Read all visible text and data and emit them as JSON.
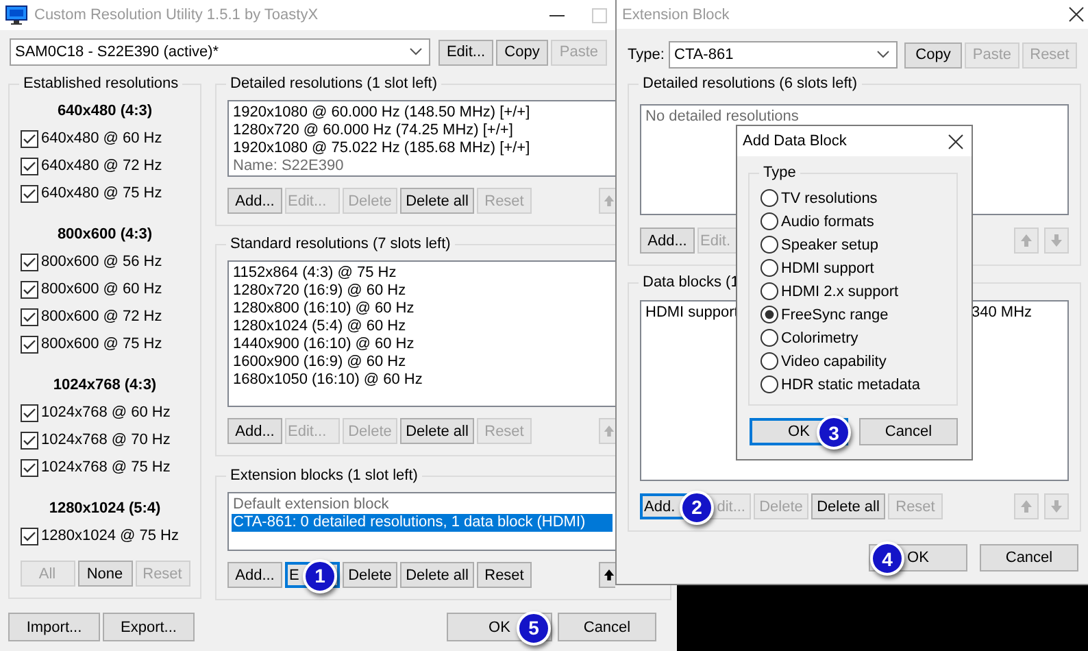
{
  "main_window": {
    "title": "Custom Resolution Utility 1.5.1 by ToastyX",
    "active": false,
    "monitor": "SAM0C18 - S22E390 (active)*",
    "top_buttons": [
      {
        "label": "Edit...",
        "disabled": false
      },
      {
        "label": "Copy",
        "disabled": false
      },
      {
        "label": "Paste",
        "disabled": true
      }
    ],
    "established": {
      "title": "Established resolutions",
      "groups": [
        {
          "heading": "640x480 (4:3)",
          "items": [
            {
              "label": "640x480 @ 60 Hz",
              "checked": true
            },
            {
              "label": "640x480 @ 72 Hz",
              "checked": true
            },
            {
              "label": "640x480 @ 75 Hz",
              "checked": true
            }
          ]
        },
        {
          "heading": "800x600 (4:3)",
          "items": [
            {
              "label": "800x600 @ 56 Hz",
              "checked": true
            },
            {
              "label": "800x600 @ 60 Hz",
              "checked": true
            },
            {
              "label": "800x600 @ 72 Hz",
              "checked": true
            },
            {
              "label": "800x600 @ 75 Hz",
              "checked": true
            }
          ]
        },
        {
          "heading": "1024x768 (4:3)",
          "items": [
            {
              "label": "1024x768 @ 60 Hz",
              "checked": true
            },
            {
              "label": "1024x768 @ 70 Hz",
              "checked": true
            },
            {
              "label": "1024x768 @ 75 Hz",
              "checked": true
            }
          ]
        },
        {
          "heading": "1280x1024 (5:4)",
          "items": [
            {
              "label": "1280x1024 @ 75 Hz",
              "checked": true
            }
          ]
        }
      ],
      "buttons": [
        {
          "label": "All",
          "disabled": true
        },
        {
          "label": "None",
          "disabled": false
        },
        {
          "label": "Reset",
          "disabled": true
        }
      ]
    },
    "detailed": {
      "title": "Detailed resolutions (1 slot left)",
      "items": [
        {
          "text": "1920x1080 @ 60.000 Hz (148.50 MHz) [+/+]",
          "kind": "entry"
        },
        {
          "text": "1280x720 @ 60.000 Hz (74.25 MHz) [+/+]",
          "kind": "entry"
        },
        {
          "text": "1920x1080 @ 75.022 Hz (185.68 MHz) [+/+]",
          "kind": "entry"
        },
        {
          "text": "Name: S22E390",
          "kind": "note"
        }
      ],
      "buttons": [
        {
          "label": "Add...",
          "disabled": false
        },
        {
          "label": "Edit...",
          "disabled": true
        },
        {
          "label": "Delete",
          "disabled": true
        },
        {
          "label": "Delete all",
          "disabled": false
        },
        {
          "label": "Reset",
          "disabled": true
        }
      ],
      "move_buttons": [
        {
          "kind": "up",
          "disabled": true
        }
      ]
    },
    "standard": {
      "title": "Standard resolutions (7 slots left)",
      "items": [
        {
          "text": "1152x864 (4:3) @ 75 Hz",
          "kind": "entry"
        },
        {
          "text": "1280x720 (16:9) @ 60 Hz",
          "kind": "entry"
        },
        {
          "text": "1280x800 (16:10) @ 60 Hz",
          "kind": "entry"
        },
        {
          "text": "1280x1024 (5:4) @ 60 Hz",
          "kind": "entry"
        },
        {
          "text": "1440x900 (16:10) @ 60 Hz",
          "kind": "entry"
        },
        {
          "text": "1600x900 (16:9) @ 60 Hz",
          "kind": "entry"
        },
        {
          "text": "1680x1050 (16:10) @ 60 Hz",
          "kind": "entry"
        }
      ],
      "buttons": [
        {
          "label": "Add...",
          "disabled": false
        },
        {
          "label": "Edit...",
          "disabled": true
        },
        {
          "label": "Delete",
          "disabled": true
        },
        {
          "label": "Delete all",
          "disabled": false
        },
        {
          "label": "Reset",
          "disabled": true
        }
      ],
      "move_buttons": [
        {
          "kind": "up",
          "disabled": true
        }
      ]
    },
    "extension": {
      "title": "Extension blocks (1 slot left)",
      "items": [
        {
          "text": "Default extension block",
          "kind": "note",
          "selected": false
        },
        {
          "text": "CTA-861: 0 detailed resolutions, 1 data block (HDMI)",
          "kind": "entry",
          "selected": true
        }
      ],
      "buttons": [
        {
          "label": "Add...",
          "disabled": false,
          "focused": false
        },
        {
          "label": "E",
          "disabled": false,
          "focused": true,
          "badge": "1"
        },
        {
          "label": "Delete",
          "disabled": false,
          "focused": false
        },
        {
          "label": "Delete all",
          "disabled": false,
          "focused": false
        },
        {
          "label": "Reset",
          "disabled": false,
          "focused": false
        }
      ],
      "move_buttons": [
        {
          "kind": "up",
          "disabled": false
        }
      ]
    },
    "file_buttons": [
      {
        "label": "Import...",
        "disabled": false
      },
      {
        "label": "Export...",
        "disabled": false
      }
    ],
    "dialog_buttons": [
      {
        "label": "OK",
        "disabled": false,
        "badge": "5"
      },
      {
        "label": "Cancel",
        "disabled": false
      }
    ]
  },
  "extension_window": {
    "title": "Extension Block",
    "active": false,
    "type_label": "Type:",
    "type": "CTA-861",
    "top_buttons": [
      {
        "label": "Copy",
        "disabled": false
      },
      {
        "label": "Paste",
        "disabled": true
      },
      {
        "label": "Reset",
        "disabled": true
      }
    ],
    "detailed": {
      "title": "Detailed resolutions (6 slots left)",
      "items": [
        {
          "text": "No detailed resolutions",
          "kind": "note"
        }
      ],
      "buttons": [
        {
          "label": "Add...",
          "disabled": false
        },
        {
          "label": "Edit.",
          "disabled": true
        }
      ],
      "move_buttons": [
        {
          "kind": "up",
          "disabled": true
        },
        {
          "kind": "down",
          "disabled": true
        }
      ]
    },
    "data_blocks": {
      "title": "Data blocks (1",
      "items": [
        {
          "start": "HDMI support",
          "end": "340 MHz"
        }
      ],
      "buttons": [
        {
          "label": "Add.",
          "disabled": false,
          "focused": true,
          "badge": "2"
        },
        {
          "label": "dit...",
          "disabled": true,
          "focused": false
        },
        {
          "label": "Delete",
          "disabled": true,
          "focused": false
        },
        {
          "label": "Delete all",
          "disabled": false,
          "focused": false
        },
        {
          "label": "Reset",
          "disabled": true,
          "focused": false
        }
      ],
      "move_buttons": [
        {
          "kind": "up",
          "disabled": true
        },
        {
          "kind": "down",
          "disabled": true
        }
      ]
    },
    "dialog_buttons": [
      {
        "label": "OK",
        "disabled": false,
        "badge": "4"
      },
      {
        "label": "Cancel",
        "disabled": false
      }
    ]
  },
  "add_dialog": {
    "title": "Add Data Block",
    "active": true,
    "group": "Type",
    "options": [
      {
        "label": "TV resolutions",
        "selected": false
      },
      {
        "label": "Audio formats",
        "selected": false
      },
      {
        "label": "Speaker setup",
        "selected": false
      },
      {
        "label": "HDMI support",
        "selected": false
      },
      {
        "label": "HDMI 2.x support",
        "selected": false
      },
      {
        "label": "FreeSync range",
        "selected": true
      },
      {
        "label": "Colorimetry",
        "selected": false
      },
      {
        "label": "Video capability",
        "selected": false
      },
      {
        "label": "HDR static metadata",
        "selected": false
      }
    ],
    "buttons": [
      {
        "label": "OK",
        "disabled": false,
        "focused": true,
        "badge": "3"
      },
      {
        "label": "Cancel",
        "disabled": false,
        "focused": false
      }
    ]
  }
}
